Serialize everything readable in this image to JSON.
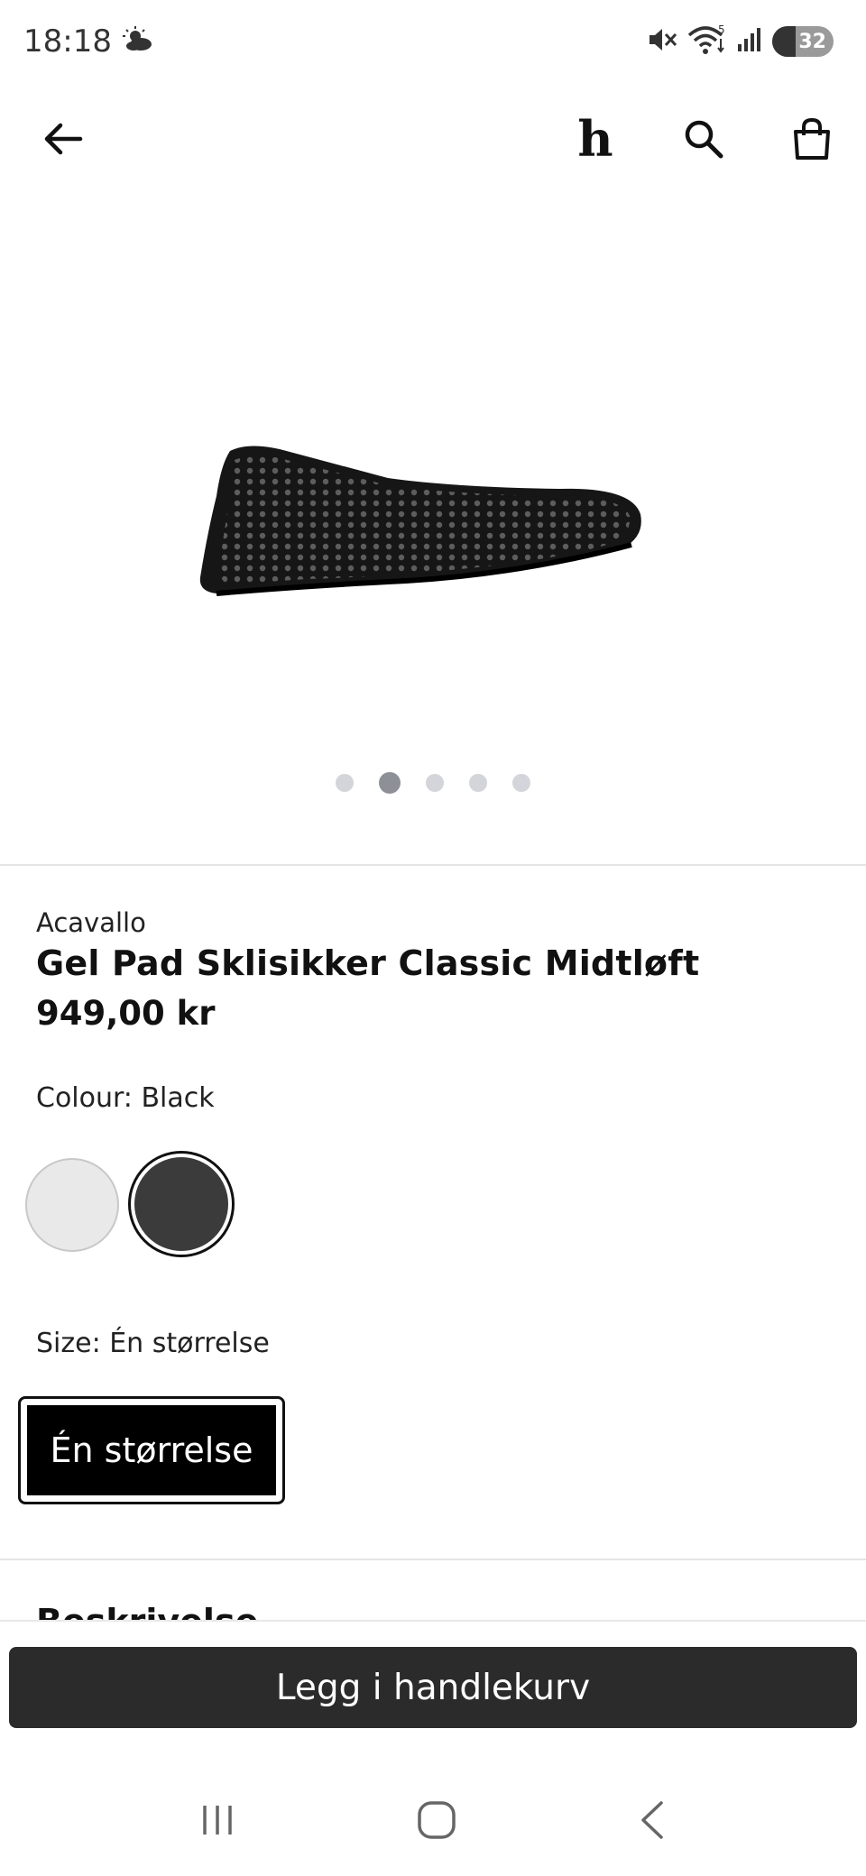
{
  "status_bar": {
    "time": "18:18",
    "battery": "32"
  },
  "header": {
    "logo_text": "h"
  },
  "carousel": {
    "dot_count": 5,
    "active_index": 1
  },
  "product": {
    "brand": "Acavallo",
    "title": "Gel Pad Sklisikker Classic Midtløft",
    "price": "949,00 kr"
  },
  "colour": {
    "label": "Colour: Black",
    "options": [
      "White",
      "Black"
    ],
    "selected": "Black"
  },
  "size": {
    "label": "Size: Én størrelse",
    "option": "Én størrelse"
  },
  "description": {
    "heading": "Beskrivelse"
  },
  "cart": {
    "button_label": "Legg i handlekurv"
  },
  "colors": {
    "primary_button": "#2b2b2b",
    "selected_size": "#000000",
    "divider": "#e4e4e4"
  }
}
